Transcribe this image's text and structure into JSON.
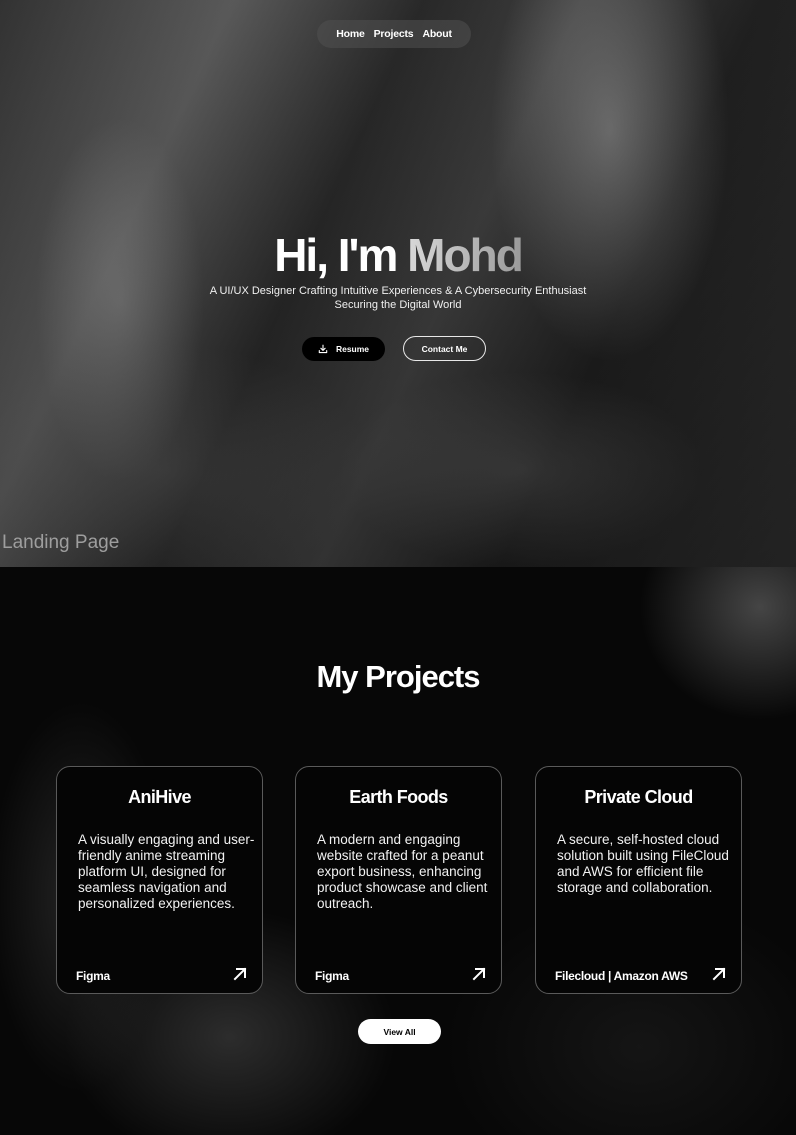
{
  "nav": {
    "items": [
      "Home",
      "Projects",
      "About"
    ]
  },
  "hero": {
    "greeting": "Hi, I'm",
    "name": "Mohd",
    "subtitle_line1": "A UI/UX Designer Crafting Intuitive Experiences & A Cybersecurity Enthusiast",
    "subtitle_line2": "Securing the Digital World",
    "resume_label": "Resume",
    "contact_label": "Contact Me"
  },
  "frame_label": "Landing Page",
  "projects": {
    "title": "My Projects",
    "cards": [
      {
        "title": "AniHive",
        "description": "A visually engaging and user-friendly anime streaming platform UI, designed for seamless navigation and personalized experiences.",
        "tech": "Figma"
      },
      {
        "title": "Earth Foods",
        "description": "A modern and engaging website crafted for a peanut export business, enhancing product showcase and client outreach.",
        "tech": "Figma"
      },
      {
        "title": "Private Cloud",
        "description": "A secure, self-hosted cloud solution built using FileCloud and AWS for efficient file storage and collaboration.",
        "tech": "Filecloud | Amazon AWS"
      }
    ],
    "view_all_label": "View All"
  },
  "icons": {
    "resume": "download-icon",
    "card_link": "arrow-up-right-icon"
  }
}
